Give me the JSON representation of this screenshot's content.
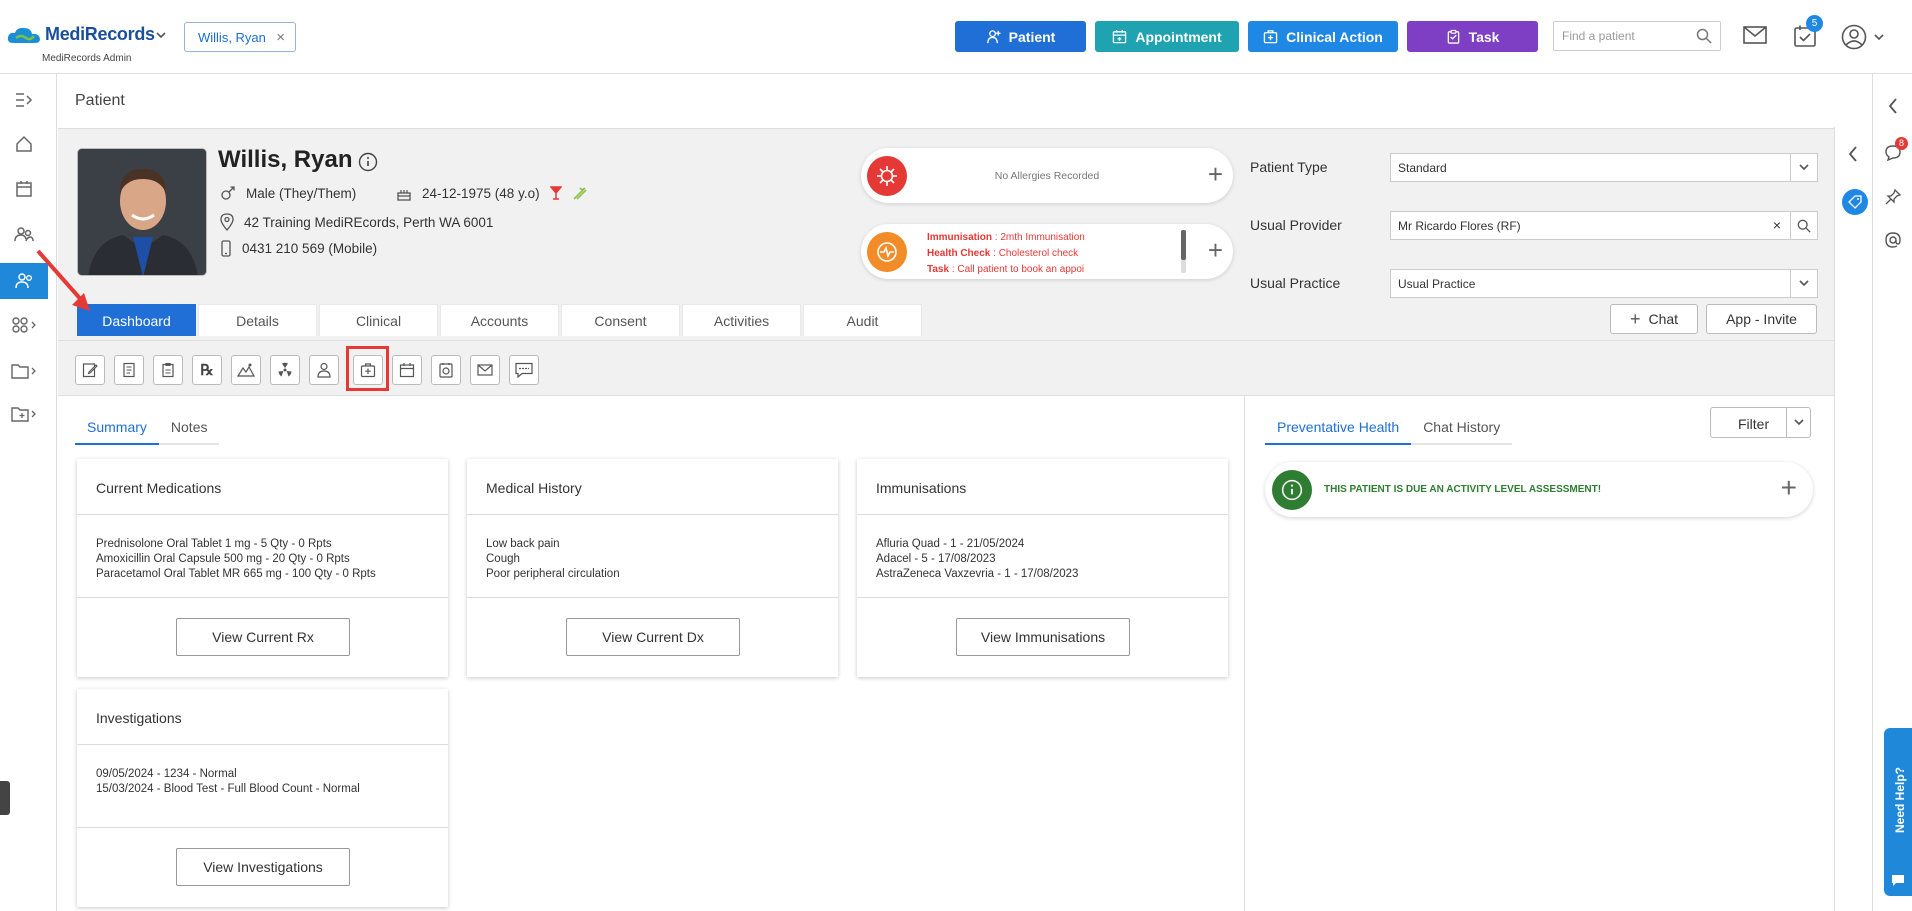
{
  "header": {
    "logo": "MediRecords",
    "logo_sub": "MediRecords Admin",
    "patient_chip": "Willis, Ryan",
    "btn_patient": "Patient",
    "btn_appointment": "Appointment",
    "btn_clinical_action": "Clinical Action",
    "btn_task": "Task",
    "search_placeholder": "Find a patient",
    "task_badge": "5"
  },
  "page": {
    "title": "Patient"
  },
  "patient": {
    "name": "Willis, Ryan",
    "gender": "Male (They/Them)",
    "dob": "24-12-1975 (48 y.o)",
    "address": "42 Training MediREcords, Perth WA 6001",
    "phone": "0431 210 569 (Mobile)"
  },
  "allergies": {
    "text": "No Allergies Recorded"
  },
  "reminders": [
    {
      "label": "Immunisation",
      "value": " : 2mth Immunisation"
    },
    {
      "label": "Health Check",
      "value": " : Cholesterol check"
    },
    {
      "label": "Task",
      "value": " : Call patient to book an appoi"
    }
  ],
  "fields": {
    "patient_type_label": "Patient Type",
    "patient_type_value": "Standard",
    "usual_provider_label": "Usual Provider",
    "usual_provider_value": "Mr Ricardo Flores (RF)",
    "usual_practice_label": "Usual Practice",
    "usual_practice_value": "Usual Practice"
  },
  "tabs": [
    "Dashboard",
    "Details",
    "Clinical",
    "Accounts",
    "Consent",
    "Activities",
    "Audit"
  ],
  "header_buttons": {
    "chat": "Chat",
    "app_invite": "App - Invite"
  },
  "subtabs": [
    "Summary",
    "Notes"
  ],
  "cards": {
    "medications": {
      "title": "Current Medications",
      "lines": [
        "Prednisolone Oral Tablet 1 mg - 5 Qty - 0 Rpts",
        "Amoxicillin Oral Capsule 500 mg - 20 Qty - 0 Rpts",
        "Paracetamol Oral Tablet MR 665 mg - 100 Qty - 0 Rpts"
      ],
      "button": "View Current Rx"
    },
    "history": {
      "title": "Medical History",
      "lines": [
        "Low back pain",
        "Cough",
        "Poor peripheral circulation"
      ],
      "button": "View Current Dx"
    },
    "immunisations": {
      "title": "Immunisations",
      "lines": [
        "Afluria Quad - 1 - 21/05/2024",
        "Adacel - 5 - 17/08/2023",
        "AstraZeneca Vaxzevria - 1 - 17/08/2023"
      ],
      "button": "View Immunisations"
    },
    "investigations": {
      "title": "Investigations",
      "lines": [
        "09/05/2024 - 1234 - Normal",
        "15/03/2024 - Blood Test - Full Blood Count - Normal"
      ],
      "button": "View Investigations"
    }
  },
  "right_panel": {
    "tabs": [
      "Preventative Health",
      "Chat History"
    ],
    "filter": "Filter",
    "alert": "THIS PATIENT IS DUE AN ACTIVITY LEVEL ASSESSMENT!"
  },
  "right_rail": {
    "badge": "8"
  },
  "need_help": "Need Help?",
  "colors": {
    "primary": "#1f6fd6",
    "teal": "#1fa3b0",
    "blue": "#1f88e5",
    "purple": "#7e3fc4",
    "red": "#e53935",
    "green": "#2e7d32"
  }
}
